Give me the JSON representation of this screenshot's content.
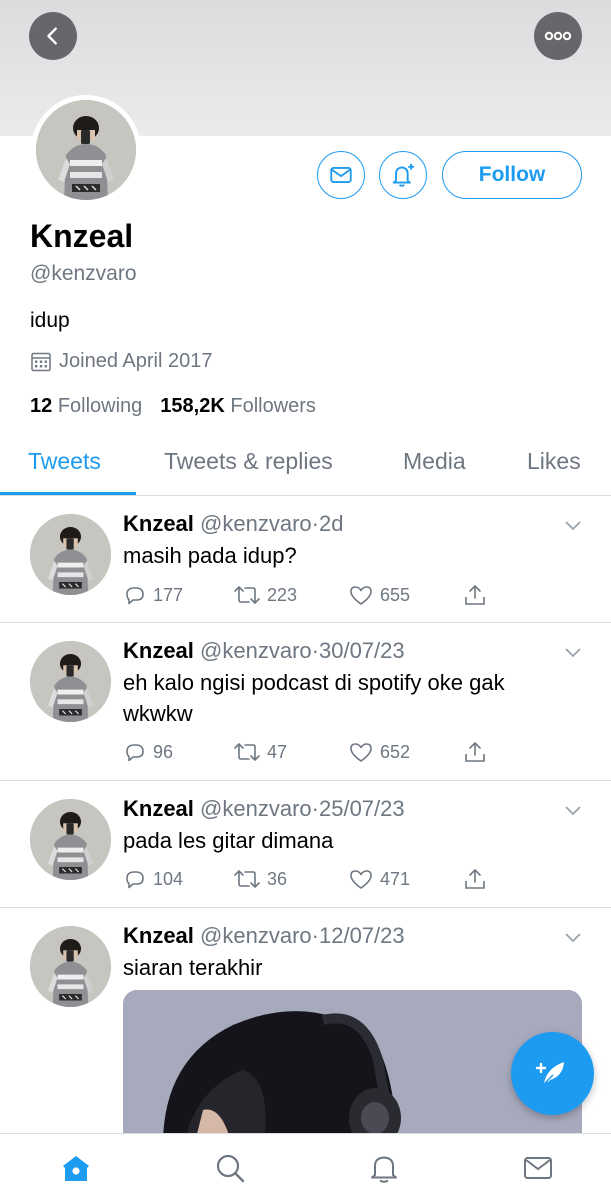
{
  "header": {
    "back_icon": "chevron-left-icon",
    "more_icon": "more-horizontal-icon"
  },
  "profile": {
    "display_name": "Knzeal",
    "handle": "@kenzvaro",
    "bio": "idup",
    "joined": "Joined April 2017",
    "following_count": "12",
    "following_label": "Following",
    "followers_count": "158,2K",
    "followers_label": "Followers"
  },
  "actions": {
    "follow_label": "Follow",
    "message_icon": "mail-icon",
    "notify_icon": "bell-plus-icon"
  },
  "tabs": [
    {
      "label": "Tweets",
      "active": true
    },
    {
      "label": "Tweets & replies",
      "active": false
    },
    {
      "label": "Media",
      "active": false
    },
    {
      "label": "Likes",
      "active": false
    }
  ],
  "tweets": [
    {
      "name": "Knzeal",
      "handle": "@kenzvaro",
      "sep": "·",
      "time": "2d",
      "text": "masih pada idup?",
      "replies": "177",
      "retweets": "223",
      "likes": "655"
    },
    {
      "name": "Knzeal",
      "handle": "@kenzvaro",
      "sep": "·",
      "time": "30/07/23",
      "text": "eh kalo ngisi podcast di spotify oke gak wkwkw",
      "replies": "96",
      "retweets": "47",
      "likes": "652"
    },
    {
      "name": "Knzeal",
      "handle": "@kenzvaro",
      "sep": "·",
      "time": "25/07/23",
      "text": "pada les gitar dimana",
      "replies": "104",
      "retweets": "36",
      "likes": "471"
    },
    {
      "name": "Knzeal",
      "handle": "@kenzvaro",
      "sep": "·",
      "time": "12/07/23",
      "text": "siaran terakhir"
    }
  ],
  "colors": {
    "accent": "#1d9bf0",
    "muted": "#6e7781",
    "divider": "#d8dde2"
  },
  "bottom_nav": [
    "home-icon",
    "search-icon",
    "bell-icon",
    "mail-icon"
  ]
}
